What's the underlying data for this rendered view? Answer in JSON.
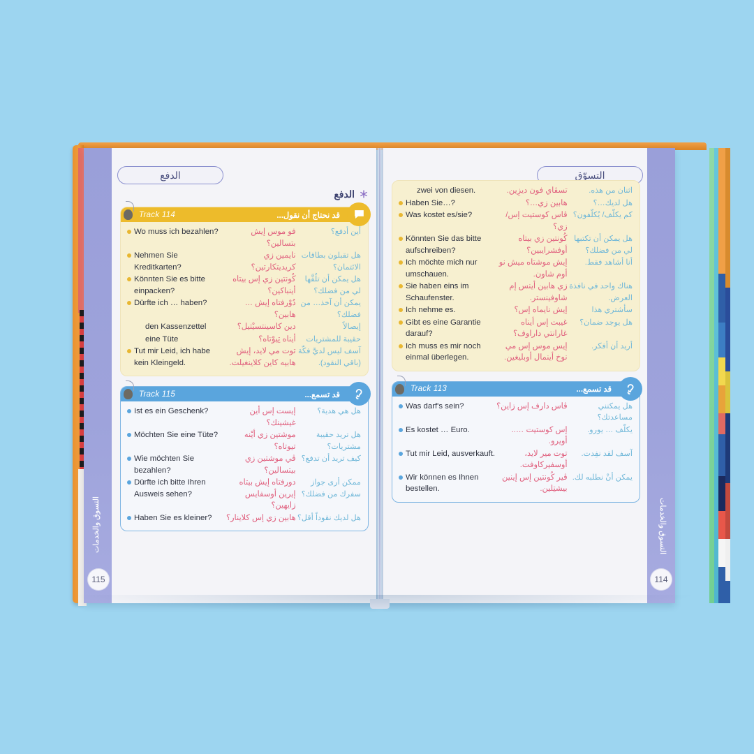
{
  "background_color": "#9dd5f0",
  "book": {
    "cover_color": "#e9912f",
    "margin_band_color": "#9a9fd9",
    "side_tab_text": "التسوق والخدمات"
  },
  "left_page": {
    "number": "115",
    "chapter_pill": "الدفع",
    "side_text": "التسوق والخدمات",
    "section_label": "الدفع",
    "boxes": [
      {
        "kind": "say",
        "track_label": "Track 114",
        "title": "قد نحتاج أن نقول...",
        "badge_icon": "speech-bubble-icon",
        "accent": "#edbb2b",
        "rows": [
          {
            "de": "Wo muss ich bezahlen?",
            "tr": "فو موس إيش بتسالين؟",
            "ar": "أين أدفع؟",
            "bullet": true,
            "indent": false
          },
          {
            "de": "Nehmen Sie Kreditkarten?",
            "tr": "نايمين زي كريديتكارتين؟",
            "ar": "هل تقبلون بطاقات الائتمان؟",
            "bullet": true,
            "indent": false
          },
          {
            "de": "Könnten Sie es bitte einpacken?",
            "tr": "كُونتين زي إس بيتاه أينباكين؟",
            "ar": "هل يمكن أن تلُفَّها لي من فضلك؟",
            "bullet": true,
            "indent": false
          },
          {
            "de": "Dürfte ich … haben?",
            "tr": "دُوْرفتاه إيش … هابين؟",
            "ar": "يمكن أن آخذ… من فضلك؟",
            "bullet": true,
            "indent": false
          },
          {
            "de": "den Kassenzettel",
            "tr": "دين كاسينتسيْتيل؟",
            "ar": "إيصالاً",
            "bullet": false,
            "indent": true
          },
          {
            "de": "eine Tüte",
            "tr": "أيناه تِيوْتاه؟",
            "ar": "حقيبة للمشتريات",
            "bullet": false,
            "indent": true
          },
          {
            "de": "Tut mir Leid, ich habe kein Kleingeld.",
            "tr": "توت مي لايد، إيش هابيه كاين كلاينغيلت.",
            "ar": "آسف ليس لديَّ فكّة (باقي النقود).",
            "bullet": true,
            "indent": false
          }
        ]
      },
      {
        "kind": "hear",
        "track_label": "Track 115",
        "title": "قد تسمع...",
        "badge_icon": "ear-icon",
        "accent": "#5aa5dd",
        "rows": [
          {
            "de": "Ist es ein Geschenk?",
            "tr": "إيست إس أين غيشينك؟",
            "ar": "هل هي هدية؟",
            "bullet": true,
            "indent": false
          },
          {
            "de": "Möchten Sie eine Tüte?",
            "tr": "موشتين زي أيْنه تيوتاه؟",
            "ar": "هل تريد حقيبة مشتريات؟",
            "bullet": true,
            "indent": false
          },
          {
            "de": "Wie möchten Sie bezahlen?",
            "tr": "ڤي موشتين زي بيتسالين؟",
            "ar": "كيف تريد أن تدفع؟",
            "bullet": true,
            "indent": false
          },
          {
            "de": "Dürfte ich bitte Ihren Ausweis sehen?",
            "tr": "دورفتاه إيش بيتاه إيرين أوسفايس زايهين؟",
            "ar": "ممكن أرى جواز سفرك من فضلك؟",
            "bullet": true,
            "indent": false
          },
          {
            "de": "Haben Sie es kleiner?",
            "tr": "هابين زي إس كلاينار؟",
            "ar": "هل لديك نقوداً أقل؟",
            "bullet": true,
            "indent": false
          }
        ]
      }
    ]
  },
  "right_page": {
    "number": "114",
    "chapter_pill": "التسوّق",
    "side_text": "التسوق والخدمات",
    "boxes": [
      {
        "kind": "say",
        "track_label": "",
        "title": "",
        "badge_icon": "",
        "accent": "#edbb2b",
        "continued": true,
        "rows": [
          {
            "de": "zwei von diesen.",
            "tr": "تسڤاي فون ديزِين.",
            "ar": "اثنان من هذه.",
            "bullet": false,
            "indent": true
          },
          {
            "de": "Haben Sie…?",
            "tr": "هابين زي…؟",
            "ar": "هل لديك…؟",
            "bullet": true,
            "indent": false
          },
          {
            "de": "Was kostet es/sie?",
            "tr": "ڤاس كوستيت إس/ زي؟",
            "ar": "كم يكلّف/ يُكلّفون؟",
            "bullet": true,
            "indent": false
          },
          {
            "de": "Könnten Sie das bitte aufschreiben?",
            "tr": "كُونتين زي بيتاه أوفشرايبين؟",
            "ar": "هل يمكن أن تكتبها لي من فضلك؟",
            "bullet": true,
            "indent": false
          },
          {
            "de": "Ich möchte mich nur umschauen.",
            "tr": "إيش موشتاه ميش نو أوم شاون.",
            "ar": "أنا أشاهد فقط.",
            "bullet": true,
            "indent": false
          },
          {
            "de": "Sie haben eins im Schaufenster.",
            "tr": "زي هابين أينس إم شاوفينستر.",
            "ar": "هناك واحد في نافذة العرض.",
            "bullet": true,
            "indent": false
          },
          {
            "de": "Ich nehme es.",
            "tr": "إيش نايماه إس؟",
            "ar": "سأشتري هذا",
            "bullet": true,
            "indent": false
          },
          {
            "de": "Gibt es eine Garantie darauf?",
            "tr": "غيبت إس أيناه غارانتي داراوف؟",
            "ar": "هل يوجد ضمان؟",
            "bullet": true,
            "indent": false
          },
          {
            "de": "Ich muss es mir noch einmal überlegen.",
            "tr": "إيس موس إس مي نوخ أينمال أوبليغين.",
            "ar": "أريد أن أفكر.",
            "bullet": true,
            "indent": false
          }
        ]
      },
      {
        "kind": "hear",
        "track_label": "Track 113",
        "title": "قد تسمع...",
        "badge_icon": "ear-icon",
        "accent": "#5aa5dd",
        "rows": [
          {
            "de": "Was darf's sein?",
            "tr": "ڤاس دارف إس زاين؟",
            "ar": "هل يمكنني مساعدتك؟",
            "bullet": true,
            "indent": false
          },
          {
            "de": "Es kostet … Euro.",
            "tr": "إس كوستيت ….. أويرو.",
            "ar": "يكلّف … يورو.",
            "bullet": true,
            "indent": false
          },
          {
            "de": "Tut mir Leid, ausverkauft.",
            "tr": "توت مير لايد، أوسفيركاوفت.",
            "ar": "آسف لقد نفِدت.",
            "bullet": true,
            "indent": false
          },
          {
            "de": "Wir können es Ihnen bestellen.",
            "tr": "ڤير كُونتين إس إينين بيشتِلين.",
            "ar": "يمكن أنْ نطلبه لك.",
            "bullet": true,
            "indent": false
          }
        ]
      }
    ]
  },
  "edge_tabs": {
    "colors": [
      "#8fd9a6",
      "#67c6dc",
      "#f0a047",
      "#e8574a",
      "#f2d84e",
      "#3c7ec4",
      "#7bc142",
      "#e06a9e",
      "#f5f5f5",
      "#2f5fa8"
    ]
  }
}
